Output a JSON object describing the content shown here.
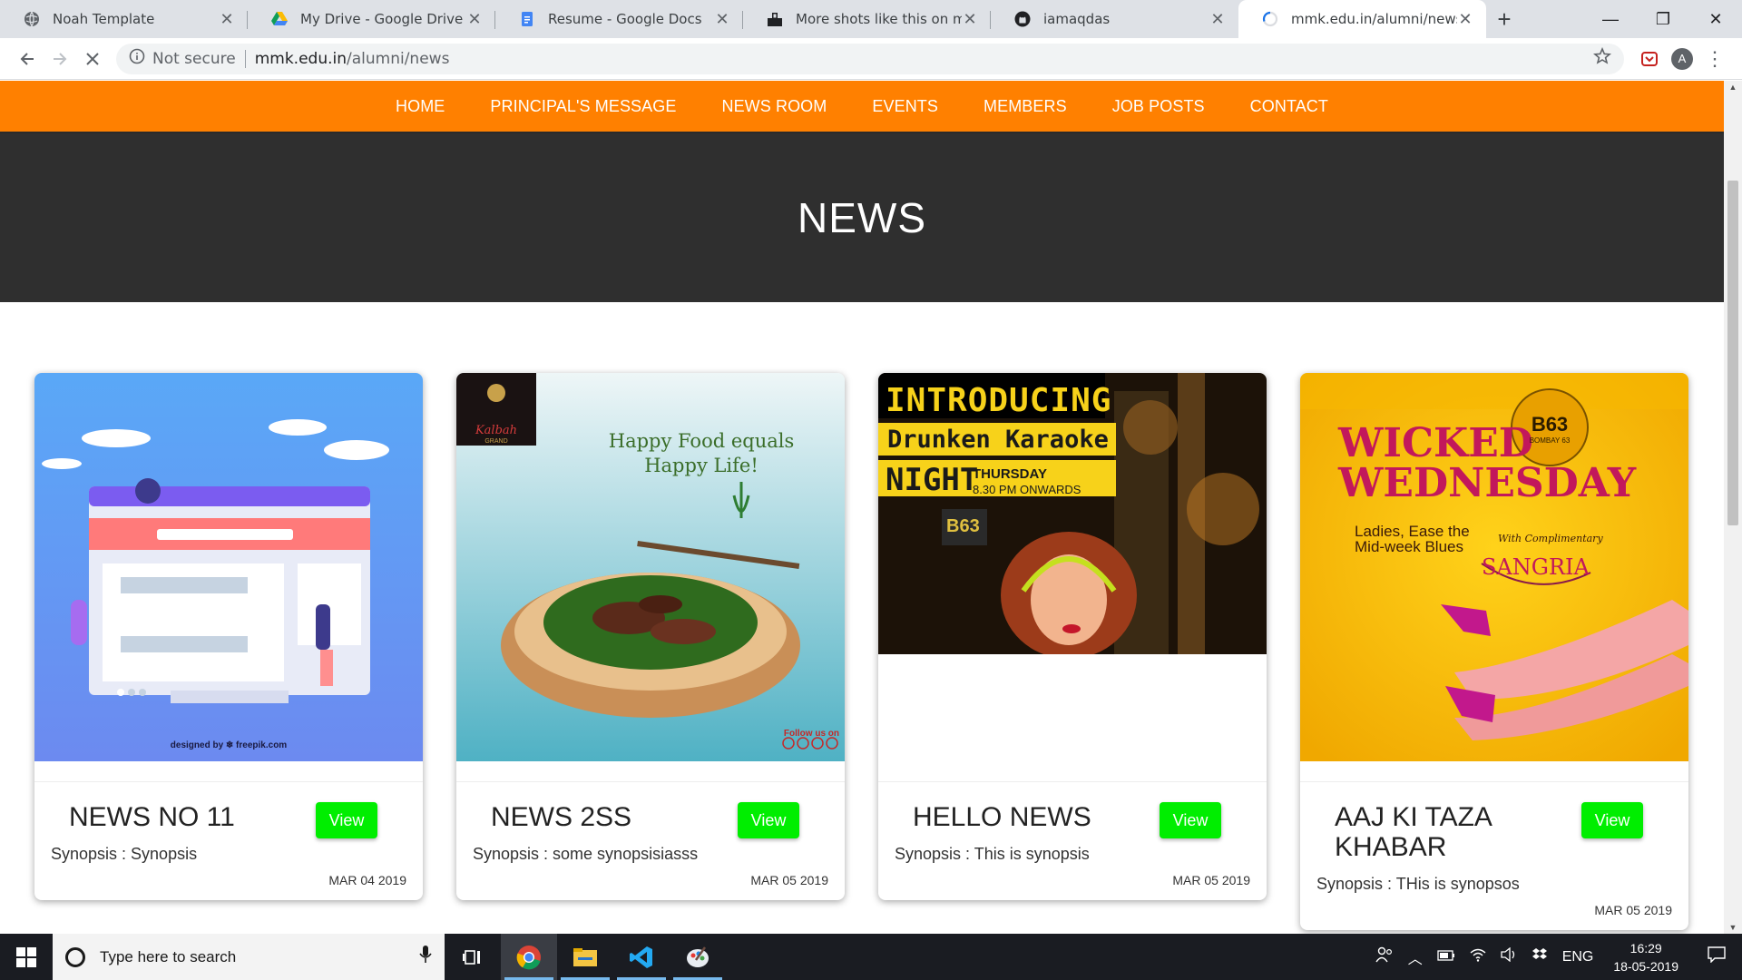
{
  "browser": {
    "tabs": [
      {
        "title": "Noah Template",
        "icon": "globe-icon",
        "active": false
      },
      {
        "title": "My Drive - Google Drive",
        "icon": "google-drive-icon",
        "active": false
      },
      {
        "title": "Resume - Google Docs",
        "icon": "google-docs-icon",
        "active": false
      },
      {
        "title": "More shots like this on my in",
        "icon": "dribbble-shot-icon",
        "active": false
      },
      {
        "title": "iamaqdas",
        "icon": "github-icon",
        "active": false
      },
      {
        "title": "mmk.edu.in/alumni/news",
        "icon": "loading-spinner-icon",
        "active": true
      }
    ],
    "new_tab": "+",
    "address": {
      "security": "Not secure",
      "host": "mmk.edu.in",
      "path": "/alumni/news"
    },
    "profile_initial": "A"
  },
  "site": {
    "nav": [
      "HOME",
      "PRINCIPAL'S MESSAGE",
      "NEWS ROOM",
      "EVENTS",
      "MEMBERS",
      "JOB POSTS",
      "CONTACT"
    ],
    "heading": "NEWS",
    "accent": "#ff8000",
    "hero_bg": "#2f2f2f",
    "button_color": "#00ee00",
    "cards": [
      {
        "title": "NEWS NO 11",
        "button": "View",
        "synopsis": "Synopsis : Synopsis",
        "date": "MAR 04 2019",
        "image": {
          "credit": "designed by ❄ freepik.com"
        }
      },
      {
        "title": "NEWS 2SS",
        "button": "View",
        "synopsis": "Synopsis : some synopsisiasss",
        "date": "MAR 05 2019",
        "image": {
          "line1": "Happy Food equals",
          "line2": "Happy Life!",
          "brand": "Kalbah",
          "brand_sub": "GRAND",
          "follow": "Follow us on"
        }
      },
      {
        "title": "HELLO NEWS",
        "button": "View",
        "synopsis": "Synopsis : This is synopsis",
        "date": "MAR 05 2019",
        "image": {
          "line1": "INTRODUCING",
          "line2": "Drunken Karaoke",
          "line3": "NIGHT",
          "day": "THURSDAY",
          "time": "8.30 PM ONWARDS",
          "sign": "B63"
        }
      },
      {
        "title": "AAJ KI TAZA KHABAR",
        "button": "View",
        "synopsis": "Synopsis : THis is synopsos",
        "date": "MAR 05 2019",
        "image": {
          "line1": "WICKED",
          "line2": "WEDNESDAY",
          "tag1": "Ladies, Ease the",
          "tag2": "Mid-week Blues",
          "extra": "With Complimentary",
          "drink": "SANGRIA",
          "logo": "B63",
          "logo_sub": "BOMBAY 63"
        }
      }
    ]
  },
  "taskbar": {
    "search_placeholder": "Type here to search",
    "apps": [
      "task-view",
      "chrome",
      "file-explorer",
      "vscode",
      "paint"
    ],
    "language": "ENG",
    "time": "16:29",
    "date": "18-05-2019"
  }
}
